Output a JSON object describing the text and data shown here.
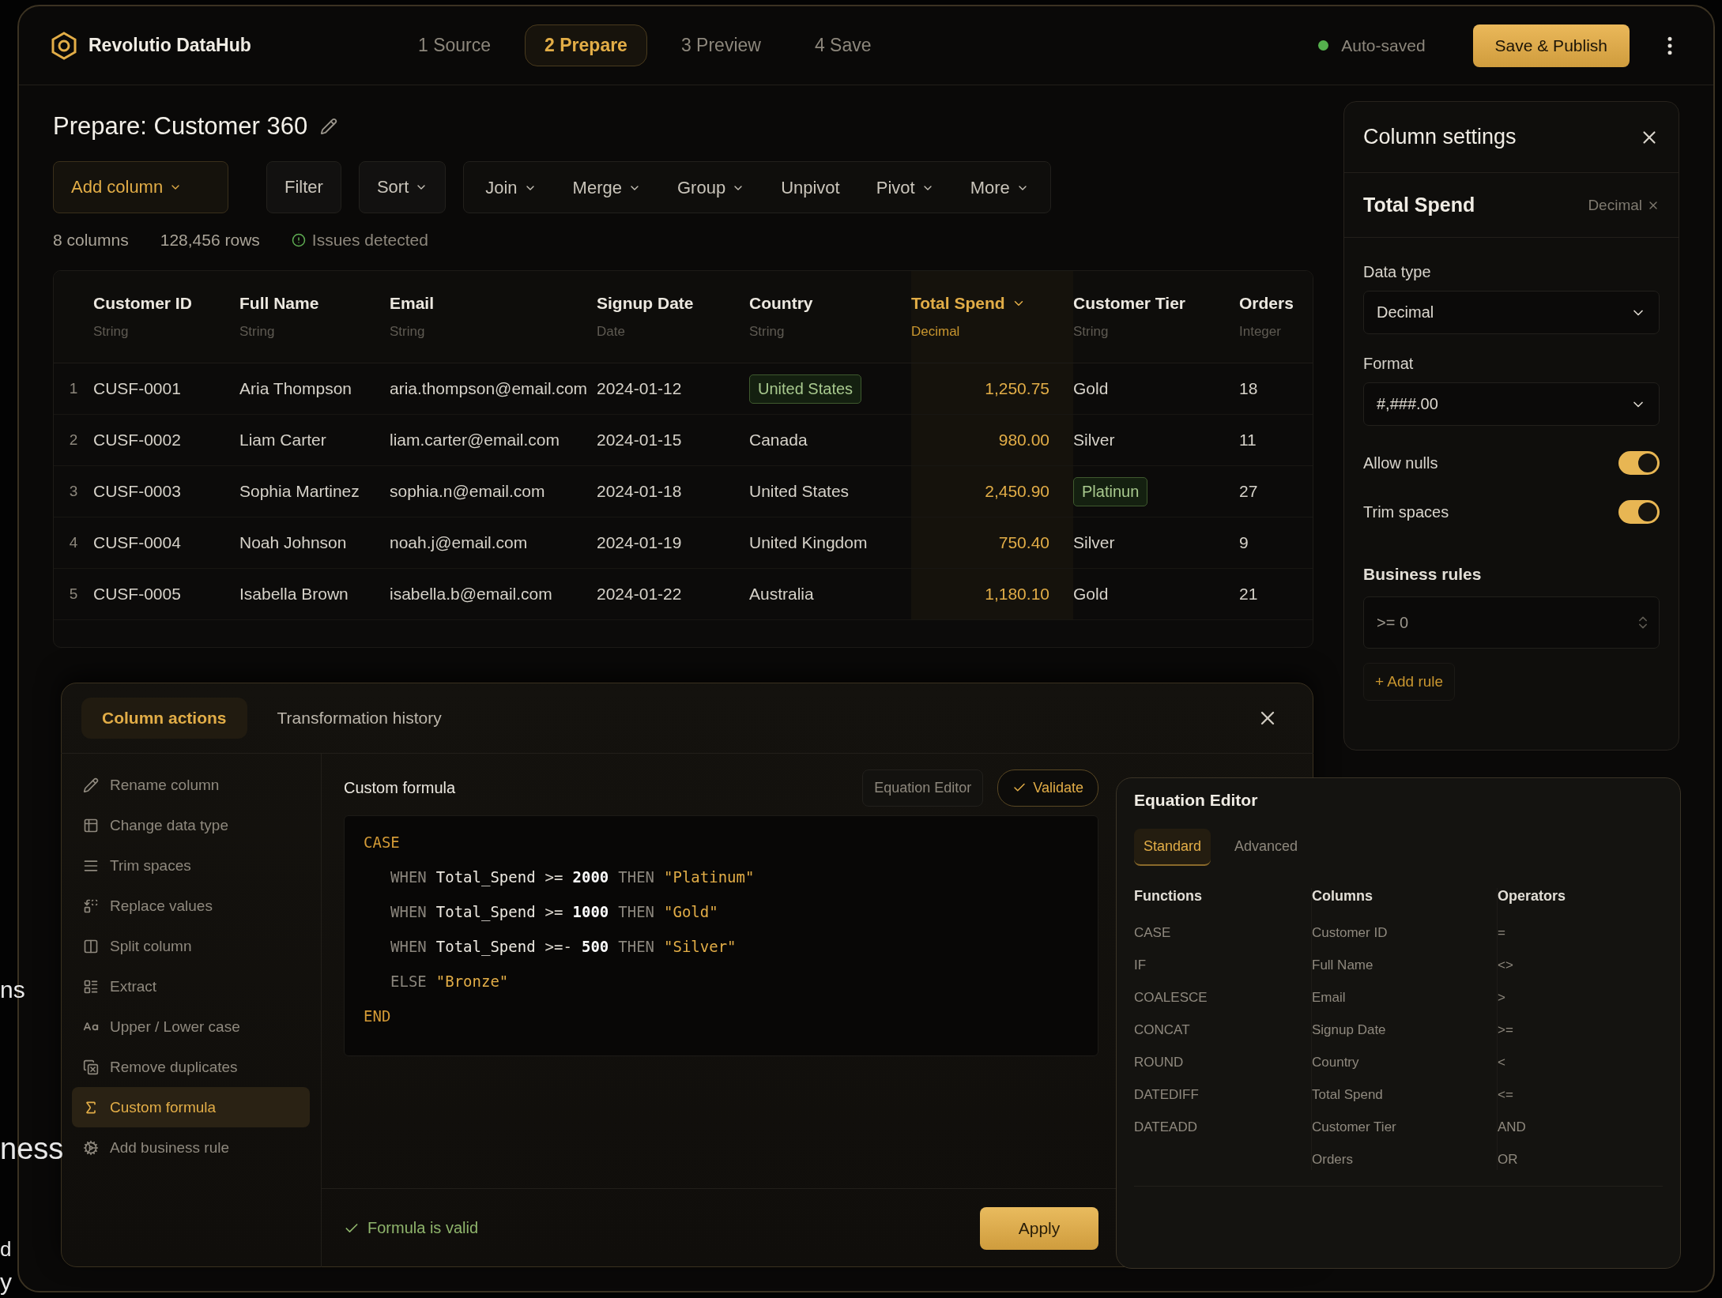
{
  "app": {
    "name": "Revolutio DataHub"
  },
  "steps": [
    {
      "number": "1",
      "label": "Source",
      "selected": false
    },
    {
      "number": "2",
      "label": "Prepare",
      "selected": true
    },
    {
      "number": "3",
      "label": "Preview",
      "selected": false
    },
    {
      "number": "4",
      "label": "Save",
      "selected": false
    }
  ],
  "save_status": "Auto-saved",
  "publish_button": "Save & Publish",
  "page": {
    "title": "Prepare: Customer 360"
  },
  "toolbar": [
    {
      "label": "Add column",
      "kind": "primary",
      "dropdown": true
    },
    {
      "label": "Filter",
      "kind": "single",
      "dropdown": false
    },
    {
      "label": "Sort",
      "kind": "single",
      "dropdown": true
    },
    {
      "label": "Join",
      "kind": "grouped",
      "dropdown": true
    },
    {
      "label": "Merge",
      "kind": "grouped",
      "dropdown": true
    },
    {
      "label": "Group",
      "kind": "grouped",
      "dropdown": true
    },
    {
      "label": "Unpivot",
      "kind": "grouped",
      "dropdown": false
    },
    {
      "label": "Pivot",
      "kind": "grouped",
      "dropdown": true
    },
    {
      "label": "More",
      "kind": "grouped",
      "dropdown": true
    }
  ],
  "stats": {
    "columns": "8 columns",
    "rows": "128,456 rows",
    "issues": "Issues detected"
  },
  "table": {
    "columns": [
      {
        "name": "Customer ID",
        "type": "String",
        "selected": false
      },
      {
        "name": "Full Name",
        "type": "String",
        "selected": false
      },
      {
        "name": "Email",
        "type": "String",
        "selected": false
      },
      {
        "name": "Signup Date",
        "type": "Date",
        "selected": false
      },
      {
        "name": "Country",
        "type": "String",
        "selected": false
      },
      {
        "name": "Total Spend",
        "type": "Decimal",
        "selected": true
      },
      {
        "name": "Customer Tier",
        "type": "String",
        "selected": false
      },
      {
        "name": "Orders",
        "type": "Integer",
        "selected": false
      }
    ],
    "rows": [
      {
        "index": "1",
        "cells": [
          {
            "text": "CUSF-0001",
            "flagged": false
          },
          {
            "text": "Aria Thompson",
            "flagged": false
          },
          {
            "text": "aria.thompson@email.com",
            "flagged": false
          },
          {
            "text": "2024-01-12",
            "flagged": false
          },
          {
            "text": "United States",
            "flagged": true
          },
          {
            "text": "1,250.75",
            "flagged": false
          },
          {
            "text": "Gold",
            "flagged": false
          },
          {
            "text": "18",
            "flagged": false
          }
        ]
      },
      {
        "index": "2",
        "cells": [
          {
            "text": "CUSF-0002",
            "flagged": false
          },
          {
            "text": "Liam Carter",
            "flagged": false
          },
          {
            "text": "liam.carter@email.com",
            "flagged": false
          },
          {
            "text": "2024-01-15",
            "flagged": false
          },
          {
            "text": "Canada",
            "flagged": false
          },
          {
            "text": "980.00",
            "flagged": false
          },
          {
            "text": "Silver",
            "flagged": false
          },
          {
            "text": "11",
            "flagged": false
          }
        ]
      },
      {
        "index": "3",
        "cells": [
          {
            "text": "CUSF-0003",
            "flagged": false
          },
          {
            "text": "Sophia Martinez",
            "flagged": false
          },
          {
            "text": "sophia.n@email.com",
            "flagged": false
          },
          {
            "text": "2024-01-18",
            "flagged": false
          },
          {
            "text": "United States",
            "flagged": false
          },
          {
            "text": "2,450.90",
            "flagged": false
          },
          {
            "text": "Platinun",
            "flagged": true
          },
          {
            "text": "27",
            "flagged": false
          }
        ]
      },
      {
        "index": "4",
        "cells": [
          {
            "text": "CUSF-0004",
            "flagged": false
          },
          {
            "text": "Noah Johnson",
            "flagged": false
          },
          {
            "text": "noah.j@email.com",
            "flagged": false
          },
          {
            "text": "2024-01-19",
            "flagged": false
          },
          {
            "text": "United Kingdom",
            "flagged": false
          },
          {
            "text": "750.40",
            "flagged": false
          },
          {
            "text": "Silver",
            "flagged": false
          },
          {
            "text": "9",
            "flagged": false
          }
        ]
      },
      {
        "index": "5",
        "cells": [
          {
            "text": "CUSF-0005",
            "flagged": false
          },
          {
            "text": "Isabella Brown",
            "flagged": false
          },
          {
            "text": "isabella.b@email.com",
            "flagged": false
          },
          {
            "text": "2024-01-22",
            "flagged": false
          },
          {
            "text": "Australia",
            "flagged": false
          },
          {
            "text": "1,180.10",
            "flagged": false
          },
          {
            "text": "Gold",
            "flagged": false
          },
          {
            "text": "21",
            "flagged": false
          }
        ]
      }
    ]
  },
  "column_settings": {
    "title": "Column settings",
    "column_name": "Total Spend",
    "column_type": "Decimal",
    "fields": [
      {
        "label": "Data type",
        "kind": "select",
        "value": "Decimal"
      },
      {
        "label": "Format",
        "kind": "select",
        "value": "#,###.00"
      },
      {
        "label": "Allow nulls",
        "kind": "toggle",
        "on": true
      },
      {
        "label": "Trim spaces",
        "kind": "toggle",
        "on": true
      }
    ],
    "rules": {
      "label": "Business rules",
      "value": ">= 0",
      "add_button": "+ Add rule"
    }
  },
  "actions_panel": {
    "tabs": [
      {
        "label": "Column actions",
        "selected": true
      },
      {
        "label": "Transformation history",
        "selected": false
      }
    ],
    "actions": [
      {
        "label": "Rename column",
        "selected": false
      },
      {
        "label": "Change data type",
        "selected": false
      },
      {
        "label": "Trim spaces",
        "selected": false
      },
      {
        "label": "Replace values",
        "selected": false
      },
      {
        "label": "Split column",
        "selected": false
      },
      {
        "label": "Extract",
        "selected": false
      },
      {
        "label": "Upper / Lower case",
        "selected": false
      },
      {
        "label": "Remove duplicates",
        "selected": false
      },
      {
        "label": "Custom formula",
        "selected": true
      },
      {
        "label": "Add business rule",
        "selected": false
      }
    ],
    "formula": {
      "title": "Custom formula",
      "editor_button": "Equation Editor",
      "validate_button": "Validate",
      "code": {
        "open": "CASE",
        "close": "END",
        "body": [
          [
            {
              "kind": "keyword",
              "text": "WHEN"
            },
            {
              "kind": "ident",
              "text": "Total_Spend"
            },
            {
              "kind": "op",
              "text": ">="
            },
            {
              "kind": "number",
              "text": "2000"
            },
            {
              "kind": "keyword",
              "text": "THEN"
            },
            {
              "kind": "string",
              "text": "\"Platinum\""
            }
          ],
          [
            {
              "kind": "keyword",
              "text": "WHEN"
            },
            {
              "kind": "ident",
              "text": "Total_Spend"
            },
            {
              "kind": "op",
              "text": ">="
            },
            {
              "kind": "number",
              "text": "1000"
            },
            {
              "kind": "keyword",
              "text": "THEN"
            },
            {
              "kind": "string",
              "text": "\"Gold\""
            }
          ],
          [
            {
              "kind": "keyword",
              "text": "WHEN"
            },
            {
              "kind": "ident",
              "text": "Total_Spend"
            },
            {
              "kind": "op",
              "text": ">=-"
            },
            {
              "kind": "number",
              "text": "500"
            },
            {
              "kind": "keyword",
              "text": "THEN"
            },
            {
              "kind": "string",
              "text": "\"Silver\""
            }
          ],
          [
            {
              "kind": "keyword",
              "text": "ELSE"
            },
            {
              "kind": "string",
              "text": "\"Bronze\""
            }
          ]
        ]
      },
      "status": "Formula is valid",
      "apply_button": "Apply"
    }
  },
  "equation_editor": {
    "title": "Equation Editor",
    "tabs": [
      {
        "label": "Standard",
        "selected": true
      },
      {
        "label": "Advanced",
        "selected": false
      }
    ],
    "lists": [
      {
        "heading": "Functions",
        "items": [
          "CASE",
          "IF",
          "COALESCE",
          "CONCAT",
          "ROUND",
          "DATEDIFF",
          "DATEADD"
        ]
      },
      {
        "heading": "Columns",
        "items": [
          "Customer ID",
          "Full Name",
          "Email",
          "Signup Date",
          "Country",
          "Total Spend",
          "Customer Tier",
          "Orders"
        ]
      },
      {
        "heading": "Operators",
        "items": [
          "=",
          "<>",
          ">",
          ">=",
          "<",
          "<=",
          "AND",
          "OR"
        ]
      }
    ]
  },
  "background_text": [
    "ns",
    "ness",
    "d",
    "y"
  ]
}
